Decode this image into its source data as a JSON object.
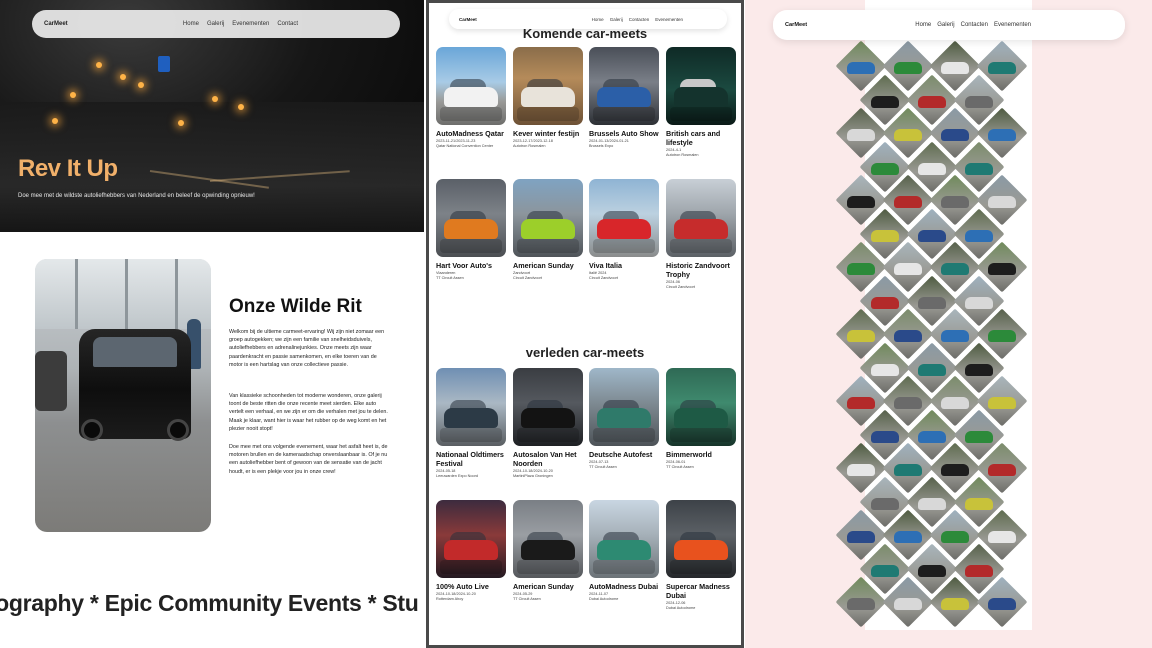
{
  "panel1": {
    "nav": {
      "brand": "CarMeet",
      "links": [
        "Home",
        "Galerij",
        "Evenementen",
        "Contact"
      ]
    },
    "hero": {
      "title": "Rev It Up",
      "subtitle": "Doe mee met de wildste autoliefhebbers van Nederland en beleef de opwinding opnieuw!"
    },
    "about": {
      "title": "Onze Wilde Rit",
      "paragraphs": [
        "Welkom bij de ultieme carmeet-ervaring! Wij zijn niet zomaar een groep autogekken; we zijn een familie van snelheidsduivels, autoliefhebbers en adrenalinejunkies. Onze meets zijn waar paardenkracht en passie samenkomen, en elke toeren van de motor is een hartslag van onze collectieve passie.",
        "Van klassieke schoonheden tot moderne wonderen, onze galerij toont de beste ritten die onze recente meet sierden. Elke auto vertelt een verhaal, en we zijn er om die verhalen met jou te delen. Maak je klaar, want hier is waar het rubber op de weg komt en het plezier nooit stopt!",
        "Doe mee met ons volgende evenement, waar het asfalt heet is, de motoren brullen en de kameraadschap onverslaanbaar is. Of je nu een autoliefhebber bent of gewoon van de sensatie van de jacht houdt, er is een plekje voor jou in onze crew!"
      ]
    },
    "marquee": "otography * Epic Community Events *  Stu"
  },
  "panel2": {
    "nav": {
      "brand": "CarMeet",
      "links": [
        "Home",
        "Galerij",
        "Contacten",
        "Evenementen"
      ]
    },
    "upcoming_title": "Komende car-meets",
    "upcoming": [
      {
        "name": "AutoMadness Qatar",
        "date": "2023-11-21/2023-11-23",
        "loc": "Qatar National Convention Center"
      },
      {
        "name": "Kever winter festijn",
        "date": "2023-12-17/2023-12-18",
        "loc": "Autotron Rosmalen"
      },
      {
        "name": "Brussels Auto Show",
        "date": "2024-01-13/2024-01-21",
        "loc": "Brussels Expo"
      },
      {
        "name": "British cars and lifestyle",
        "date": "2024-4-1",
        "loc": "Autotron Rosmalen"
      },
      {
        "name": "Hart Voor Auto's",
        "date": "Vlaanderen",
        "loc": "TT Circuit Assen"
      },
      {
        "name": "American Sunday",
        "date": "Zandvoort",
        "loc": "Circuit Zandvoort"
      },
      {
        "name": "Viva Italia",
        "date": "Italië 2024",
        "loc": "Circuit Zandvoort"
      },
      {
        "name": "Historic Zandvoort Trophy",
        "date": "2024-06",
        "loc": "Circuit Zandvoort"
      }
    ],
    "past_title": "verleden car-meets",
    "past": [
      {
        "name": "Nationaal Oldtimers Festival",
        "date": "2024-05-18",
        "loc": "Leeuwarden Expo Noord"
      },
      {
        "name": "Autosalon Van Het Noorden",
        "date": "2024-10-18/2024-10-20",
        "loc": "MartiniPlaza Groningen"
      },
      {
        "name": "Deutsche Autofest",
        "date": "2024-07-13",
        "loc": "TT Circuit Assen"
      },
      {
        "name": "Bimmerworld",
        "date": "2024-06-01",
        "loc": "TT Circuit Assen"
      },
      {
        "name": "100% Auto Live",
        "date": "2024-10-18/2024-10-20",
        "loc": "Rotterdam Ahoy"
      },
      {
        "name": "American Sunday",
        "date": "2024-05-29",
        "loc": "TT Circuit Assen"
      },
      {
        "name": "AutoMadness Dubai",
        "date": "2024-11-07",
        "loc": "Dubai Autodrome"
      },
      {
        "name": "Supercar Madness Dubai",
        "date": "2024-12-06",
        "loc": "Dubai Autodrome"
      }
    ]
  },
  "panel3": {
    "nav": {
      "brand": "CarMeet",
      "links": [
        "Home",
        "Galerij",
        "Contacten",
        "Evenementen"
      ]
    }
  },
  "colors": {
    "accent": "#f1b06a",
    "page_pink": "#fbeaea",
    "text": "#111111"
  }
}
